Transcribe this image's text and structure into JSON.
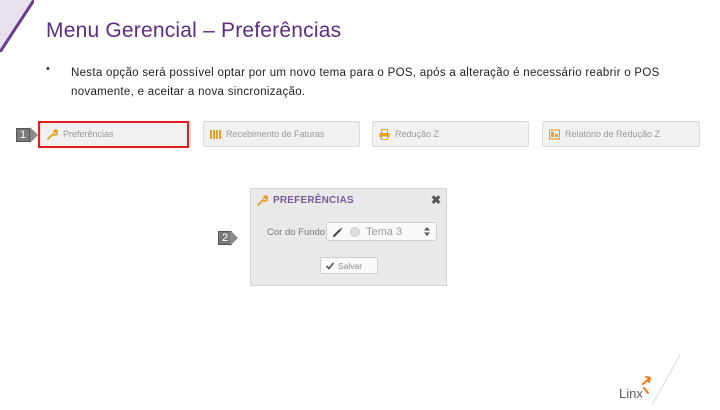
{
  "slide": {
    "title": "Menu Gerencial – Preferências",
    "bullet": "•",
    "text": "Nesta opção será possível optar por um novo tema para o POS, após a alteração é necessário reabrir o POS novamente, e aceitar a nova sincronização."
  },
  "toolbar": {
    "items": [
      {
        "label": "Preferências",
        "icon": "wrench-icon"
      },
      {
        "label": "Recebimento de Faturas",
        "icon": "barcode-icon"
      },
      {
        "label": "Redução Z",
        "icon": "printer-icon"
      },
      {
        "label": "Relatório de Redução Z",
        "icon": "report-icon"
      }
    ]
  },
  "steps": {
    "one": "1",
    "two": "2"
  },
  "dialog": {
    "title": "PREFERÊNCIAS",
    "close": "✖",
    "field_label": "Cor do Fundo:",
    "selected_theme": "Tema 3",
    "save_label": "Salvar"
  },
  "logo": {
    "text": "Linx"
  },
  "colors": {
    "title": "#5c2d82",
    "accent": "#7a3fa0",
    "highlight": "#e02020",
    "logo_orange": "#f07c1e"
  }
}
